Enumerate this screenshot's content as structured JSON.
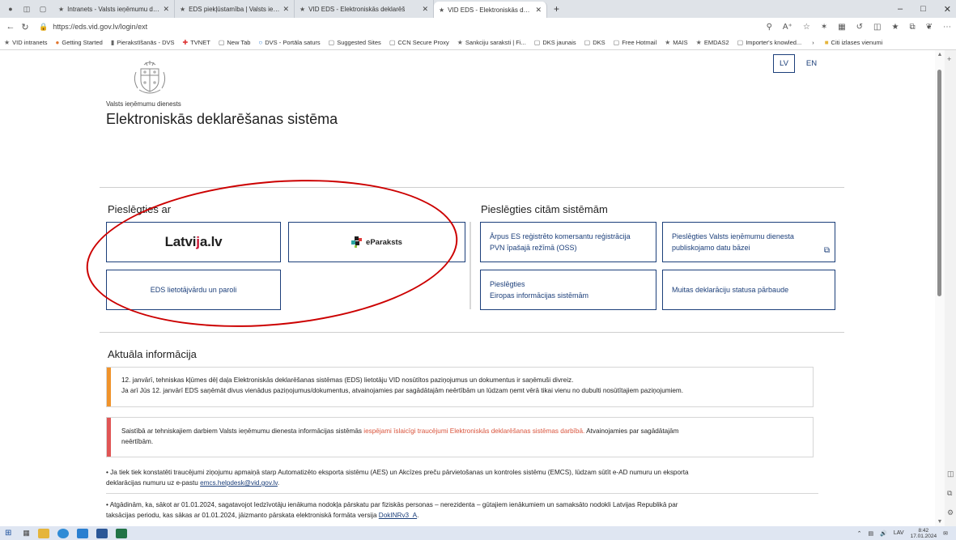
{
  "browser": {
    "tabs": [
      {
        "title": "Intranets - Valsts ieņēmumu dien",
        "active": false
      },
      {
        "title": "EDS piekļūstamība | Valsts ieņēm",
        "active": false
      },
      {
        "title": "VID EDS - Elektroniskās deklarēš",
        "active": false
      },
      {
        "title": "VID EDS - Elektroniskās deklarēš",
        "active": true
      }
    ],
    "new_tab": "+",
    "url": "https://eds.vid.gov.lv/login/ext",
    "bookmarks": [
      "VID intranets",
      "Getting Started",
      "Pierakstīšanās - DVS",
      "TVNET",
      "New Tab",
      "DVS - Portāla saturs",
      "Suggested Sites",
      "CCN Secure Proxy",
      "Sankciju saraksti | Fi...",
      "DKS jaunais",
      "DKS",
      "Free Hotmail",
      "MAIS",
      "EMDAS2",
      "Importer's knowled..."
    ],
    "other_favorites": "Citi izlases vienumi"
  },
  "header": {
    "agency": "Valsts ieņēmumu dienests",
    "system_title": "Elektroniskās deklarēšanas sistēma",
    "lang_lv": "LV",
    "lang_en": "EN"
  },
  "login": {
    "heading": "Pieslēgties ar",
    "latvija_a": "Latvi",
    "latvija_j": "j",
    "latvija_b": "a.lv",
    "eparaksts": "eParaksts",
    "eds_password": "EDS lietotājvārdu un paroli"
  },
  "other_systems": {
    "heading": "Pieslēgties citām sistēmām",
    "oss_line1": "Ārpus ES reģistrēto komersantu reģistrācija",
    "oss_line2": "PVN īpašajā režīmā (OSS)",
    "public_db_line1": "Pieslēgties Valsts ieņēmumu dienesta",
    "public_db_line2": "publiskojamo datu bāzei",
    "eu_line1": "Pieslēgties",
    "eu_line2": "Eiropas informācijas sistēmām",
    "customs_status": "Muitas deklarāciju statusa pārbaude"
  },
  "news": {
    "heading": "Aktuāla informācija",
    "notice1_line1": "12. janvārī, tehniskas kļūmes dēļ daļa Elektroniskās deklarēšanas sistēmas (EDS) lietotāju VID nosūtītos paziņojumus un dokumentus ir saņēmuši divreiz.",
    "notice1_line2": "Ja arī Jūs 12. janvārī EDS saņēmāt divus vienādus paziņojumus/dokumentus, atvainojamies par sagādātajām neērtībām un lūdzam ņemt vērā tikai vienu no dubulti nosūtītajiem paziņojumiem.",
    "notice2_a": "Saistībā ar tehniskajiem darbiem Valsts ieņēmumu dienesta informācijas sistēmās ",
    "notice2_warn": "iespējami īslaicīgi traucējumi Elektroniskās deklarēšanas sistēmas darbībā.",
    "notice2_b": " Atvainojamies par sagādātajām",
    "notice2_c": "neērtībām.",
    "para1_a": "• Ja tiek tiek konstatēti traucējumi ziņojumu apmaiņā starp Automatizēto eksporta sistēmu (AES) un Akcīzes preču pārvietošanas un kontroles sistēmu (EMCS), lūdzam sūtīt e-AD numuru un eksporta",
    "para1_b": "deklarācijas numuru uz e-pastu ",
    "para1_link": "emcs.helpdesk@vid.gov.lv",
    "para1_end": ".",
    "para2_a": "• Atgādinām, ka, sākot ar 01.01.2024, sagatavojot Iedzīvotāju ienākuma nodokļa pārskatu par fiziskās personas – nerezidenta – gūtajiem ienākumiem un samaksāto nodokli Latvijas Republikā par",
    "para2_b": "taksācijas periodu, kas sākas ar 01.01.2024, jāizmanto pārskata  elektroniskā formāta versija ",
    "para2_link": "DokINRv3_A",
    "para2_end": "."
  },
  "taskbar": {
    "lang": "LAV",
    "time": "8:42",
    "date": "17.01.2024"
  },
  "colors": {
    "accent": "#1c3f7a",
    "notice_orange": "#f0932b",
    "notice_red": "#e05555",
    "annotation": "#cc0000"
  }
}
